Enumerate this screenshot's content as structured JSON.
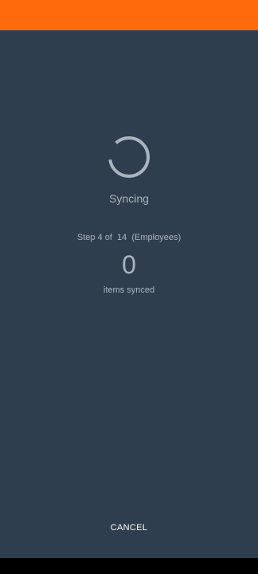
{
  "colors": {
    "status_bar": "#ff6a0d",
    "background": "#2f3e4e",
    "text_muted": "#a9b4bf",
    "button_text": "#ffffff",
    "nav_bar": "#000000"
  },
  "sync": {
    "title": "Syncing",
    "step_text": "Step 4 of  14  (Employees)",
    "count": "0",
    "count_label": "items synced",
    "cancel_label": "CANCEL"
  }
}
